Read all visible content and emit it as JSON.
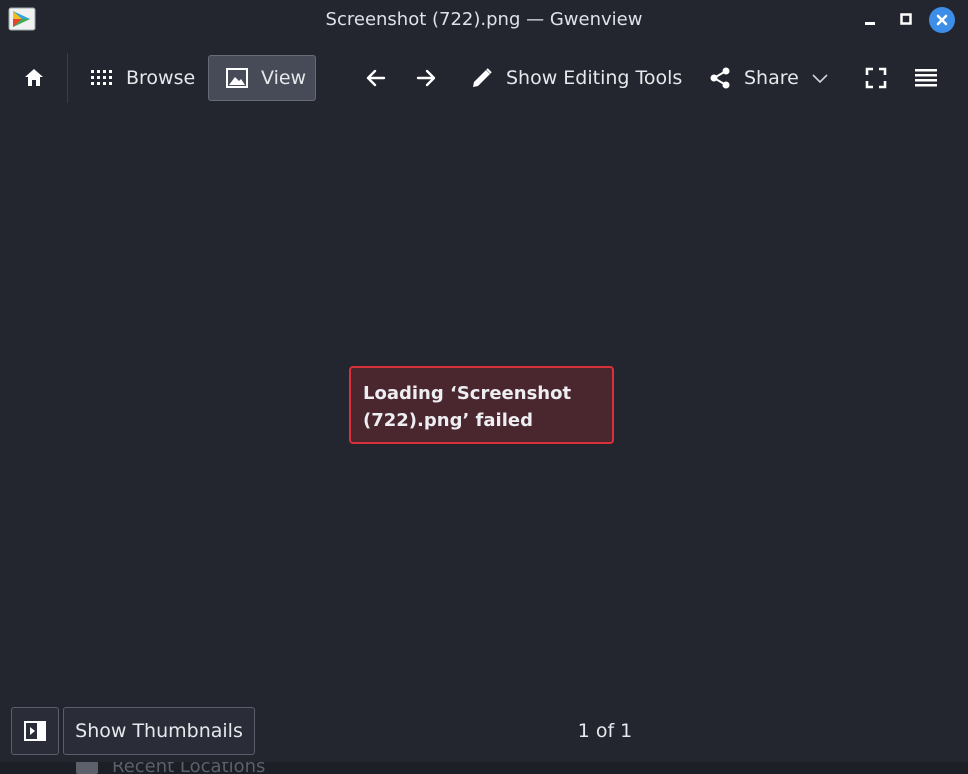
{
  "window": {
    "title": "Screenshot (722).png — Gwenview",
    "app_icon": "gwenview-app-icon",
    "controls": [
      "minimize-icon",
      "maximize-icon",
      "close-icon"
    ],
    "accent_color": "#3d8ee8"
  },
  "toolbar": {
    "home_icon": "home-icon",
    "browse_label": "Browse",
    "view_label": "View",
    "back_icon": "arrow-left-icon",
    "forward_icon": "arrow-right-icon",
    "edit_label": "Show Editing Tools",
    "share_label": "Share",
    "fullscreen_icon": "fullscreen-icon",
    "menu_icon": "hamburger-menu-icon"
  },
  "main": {
    "error_message": "Loading ‘Screenshot (722).png’ failed",
    "error_color": "#d8313c"
  },
  "statusbar": {
    "sidebar_toggle_icon": "sidebar-toggle-icon",
    "thumbnails_label": "Show Thumbnails",
    "page_count": "1 of 1"
  },
  "background_window": {
    "partial_text": "Recent Locations"
  }
}
